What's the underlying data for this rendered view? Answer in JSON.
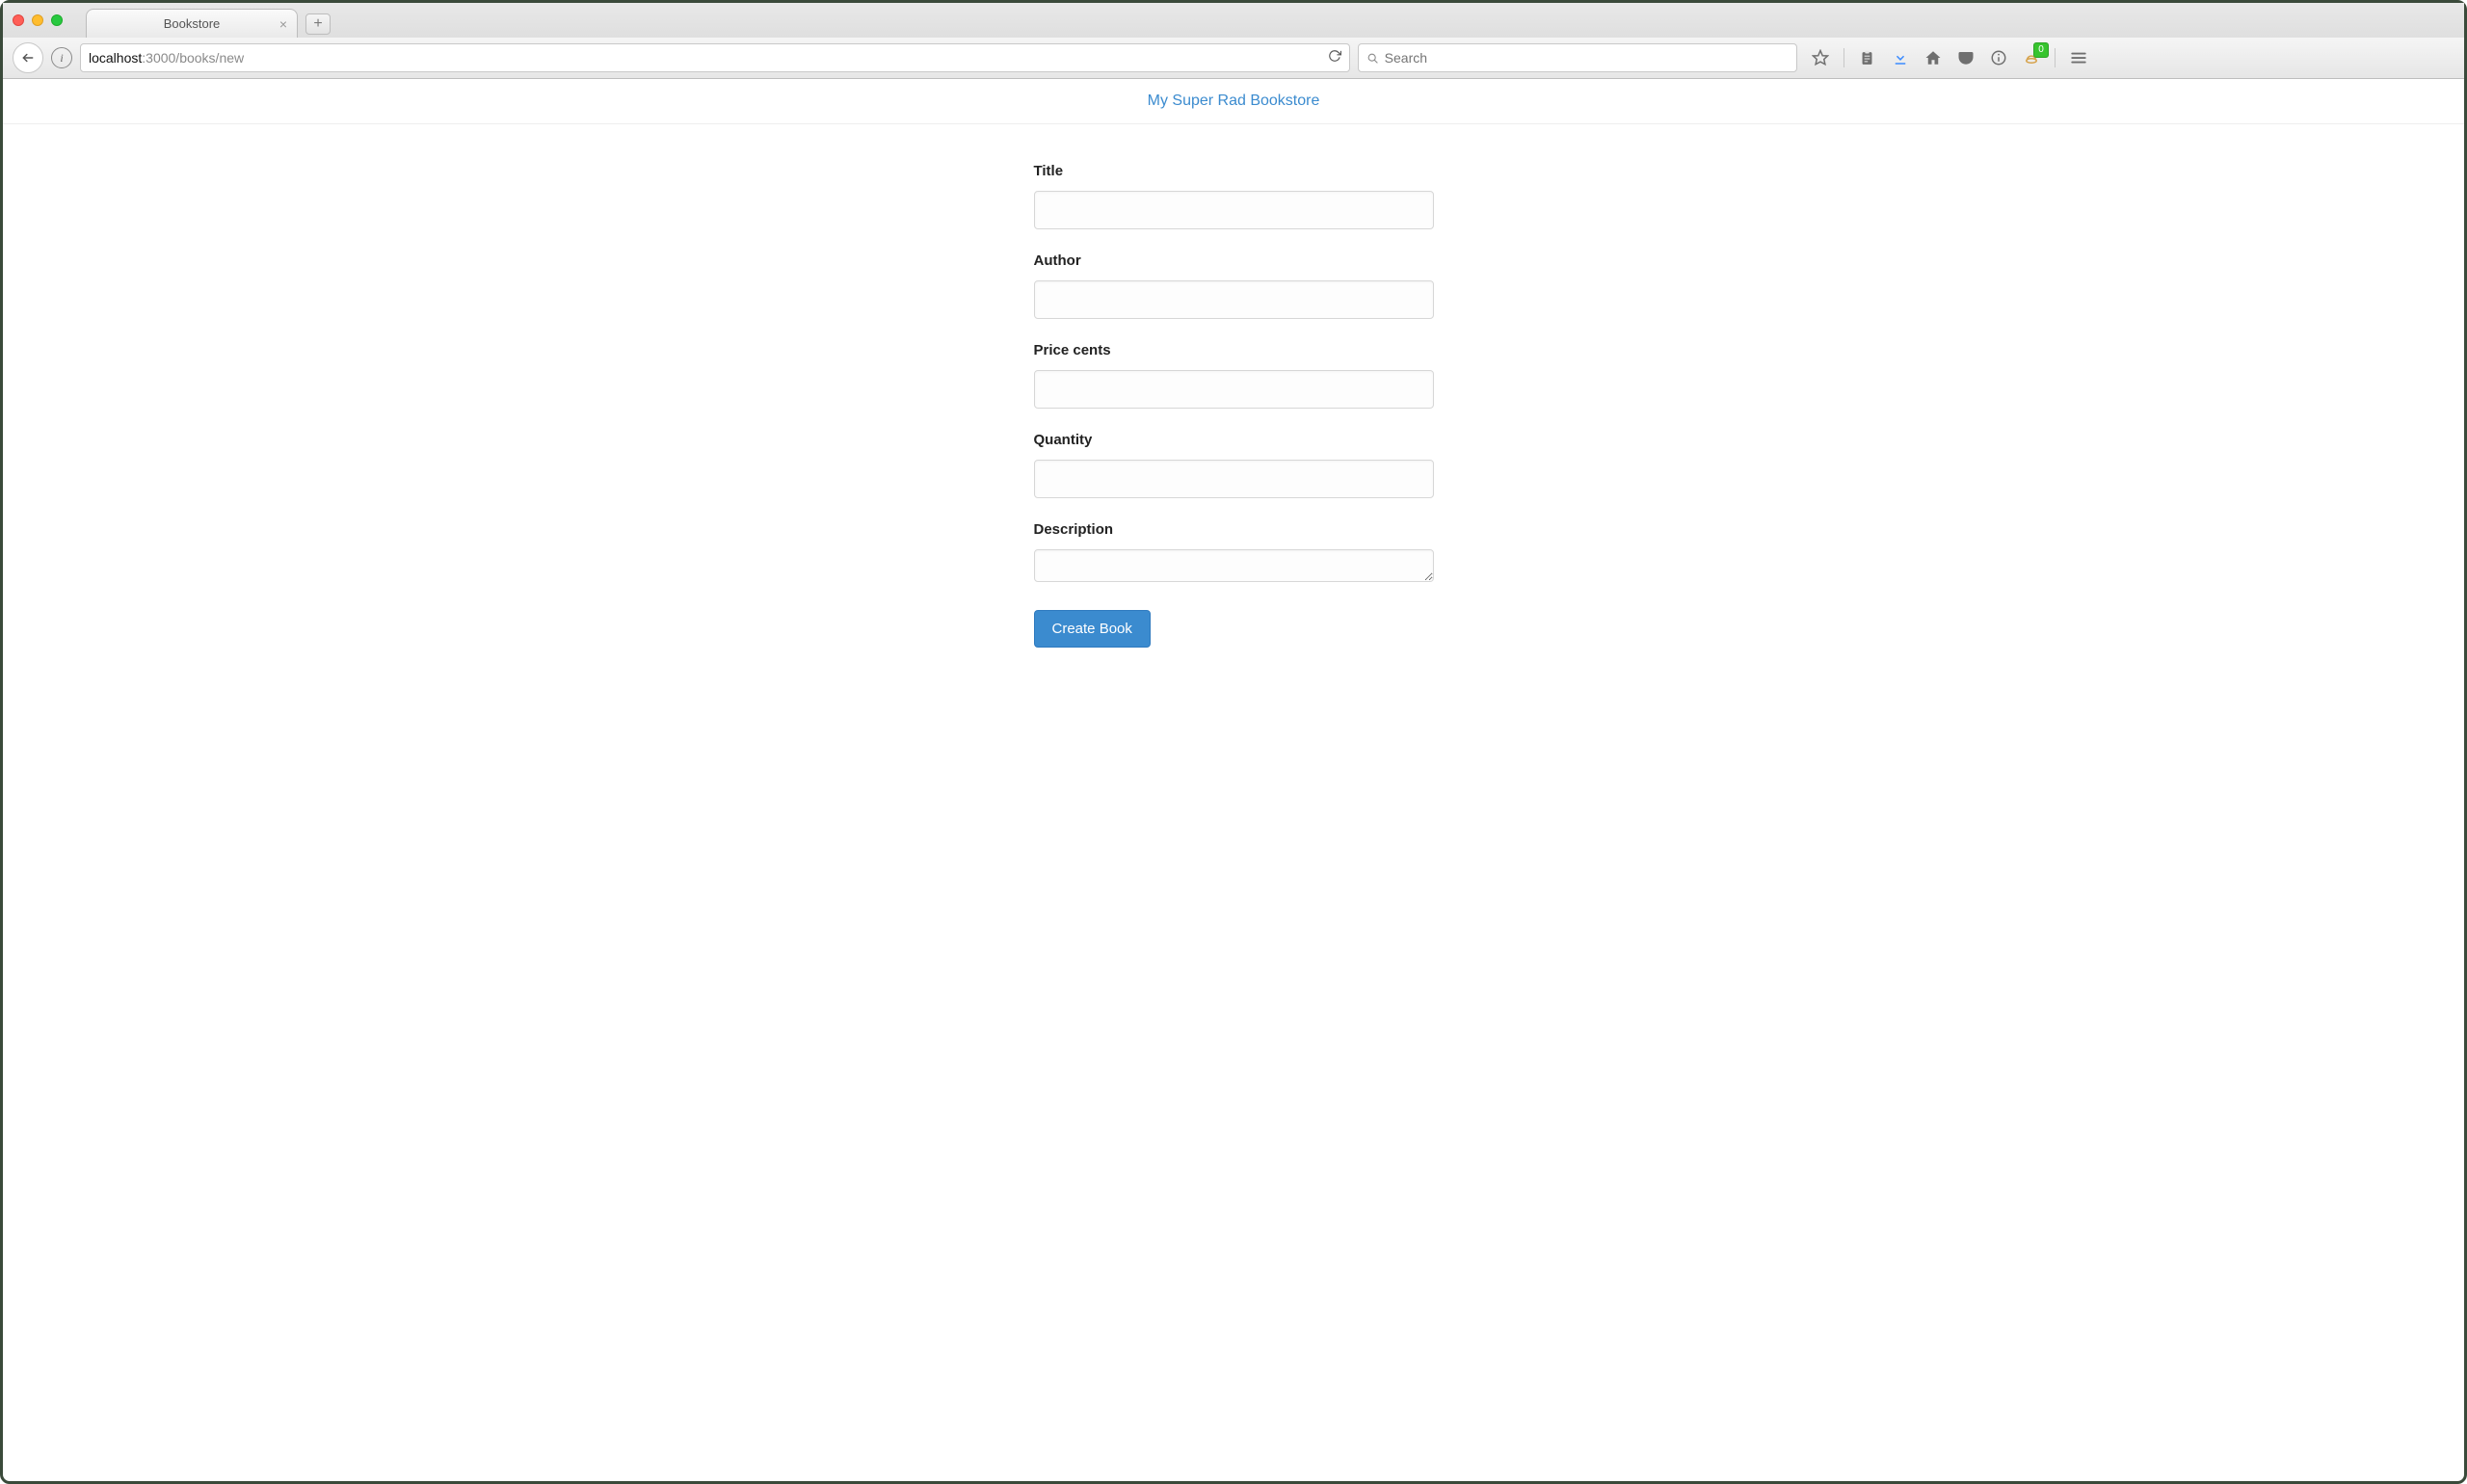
{
  "browser": {
    "tab_title": "Bookstore",
    "url_host": "localhost",
    "url_port_path": ":3000/books/new",
    "search_placeholder": "Search",
    "badge_count": "0"
  },
  "header": {
    "brand": "My Super Rad Bookstore"
  },
  "form": {
    "title_label": "Title",
    "author_label": "Author",
    "price_label": "Price cents",
    "quantity_label": "Quantity",
    "description_label": "Description",
    "title_value": "",
    "author_value": "",
    "price_value": "",
    "quantity_value": "",
    "description_value": "",
    "submit_label": "Create Book"
  }
}
